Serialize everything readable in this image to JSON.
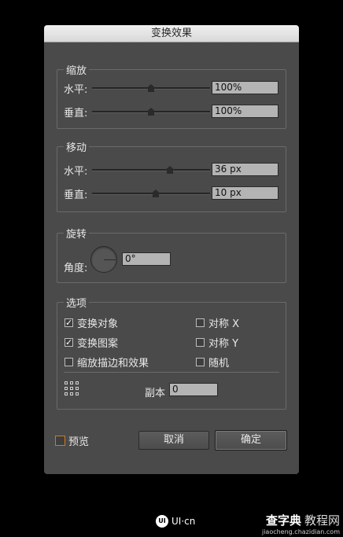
{
  "dialog": {
    "title": "变换效果",
    "scale": {
      "legend": "缩放",
      "horizontal": {
        "label": "水平:",
        "value": "100%",
        "slider": 0.5
      },
      "vertical": {
        "label": "垂直:",
        "value": "100%",
        "slider": 0.5
      }
    },
    "move": {
      "legend": "移动",
      "horizontal": {
        "label": "水平:",
        "value": "36 px",
        "slider": 0.66
      },
      "vertical": {
        "label": "垂直:",
        "value": "10 px",
        "slider": 0.54
      }
    },
    "rotate": {
      "legend": "旋转",
      "angle_label": "角度:",
      "angle_value": "0°"
    },
    "options": {
      "legend": "选项",
      "transform_objects": {
        "label": "变换对象",
        "checked": true
      },
      "transform_patterns": {
        "label": "变换图案",
        "checked": true
      },
      "scale_strokes": {
        "label": "缩放描边和效果",
        "checked": false
      },
      "reflect_x": {
        "label": "对称 X",
        "checked": false
      },
      "reflect_y": {
        "label": "对称 Y",
        "checked": false
      },
      "random": {
        "label": "随机",
        "checked": false
      },
      "copies_label": "副本",
      "copies_value": "0"
    },
    "preview": {
      "label": "预览",
      "checked": false
    },
    "cancel_label": "取消",
    "ok_label": "确定"
  },
  "branding": {
    "logo_text": "UI·cn",
    "logo_mark": "UI",
    "watermark_main": "查字典",
    "watermark_tag": "教程网",
    "watermark_url": "jiaocheng.chazidian.com"
  }
}
